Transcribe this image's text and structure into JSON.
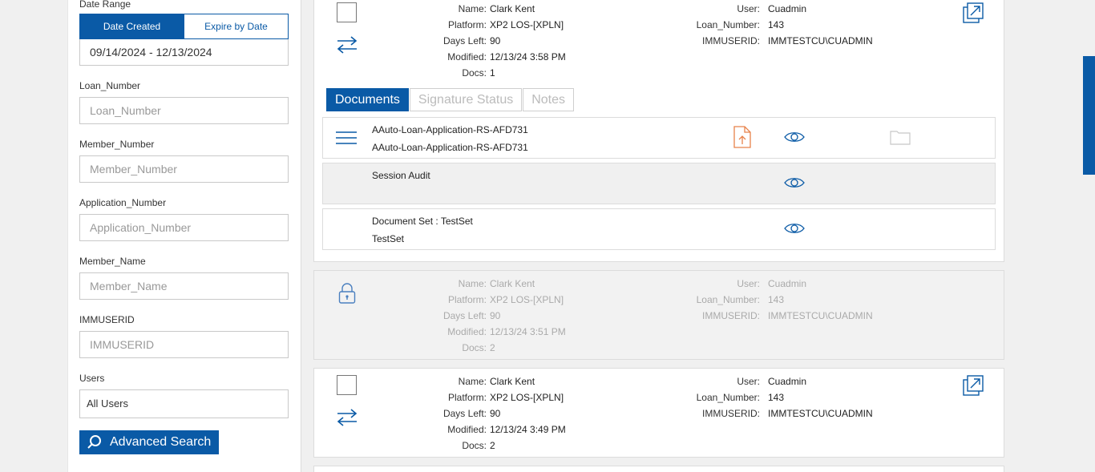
{
  "filters": {
    "date_range_label": "Date Range",
    "date_created_label": "Date Created",
    "expire_by_date_label": "Expire by Date",
    "date_range_value": "09/14/2024 - 12/13/2024",
    "loan_number_label": "Loan_Number",
    "loan_number_placeholder": "Loan_Number",
    "member_number_label": "Member_Number",
    "member_number_placeholder": "Member_Number",
    "application_number_label": "Application_Number",
    "application_number_placeholder": "Application_Number",
    "member_name_label": "Member_Name",
    "member_name_placeholder": "Member_Name",
    "immuserid_label": "IMMUSERID",
    "immuserid_placeholder": "IMMUSERID",
    "users_label": "Users",
    "users_value": "All Users",
    "advanced_search_label": "Advanced Search"
  },
  "field_labels": {
    "name": "Name:",
    "platform": "Platform:",
    "days_left": "Days Left:",
    "modified": "Modified:",
    "docs": "Docs:",
    "user": "User:",
    "loan_number": "Loan_Number:",
    "immuserid": "IMMUSERID:"
  },
  "cards": [
    {
      "name": "Clark Kent",
      "platform": "XP2 LOS-[XPLN]",
      "days_left": "90",
      "modified": "12/13/24 3:58 PM",
      "docs": "1",
      "user": "Cuadmin",
      "loan_number": "143",
      "immuserid": "IMMTESTCU\\CUADMIN",
      "tabs": [
        "Documents",
        "Signature Status",
        "Notes"
      ],
      "documents": [
        {
          "line1": "AAuto-Loan-Application-RS-AFD731",
          "line2": "AAuto-Loan-Application-RS-AFD731"
        },
        {
          "line1": "Session Audit",
          "line2": ""
        },
        {
          "line1": "Document Set : TestSet",
          "line2": "TestSet"
        }
      ]
    },
    {
      "name": "Clark Kent",
      "platform": "XP2 LOS-[XPLN]",
      "days_left": "90",
      "modified": "12/13/24 3:51 PM",
      "docs": "2",
      "user": "Cuadmin",
      "loan_number": "143",
      "immuserid": "IMMTESTCU\\CUADMIN"
    },
    {
      "name": "Clark Kent",
      "platform": "XP2 LOS-[XPLN]",
      "days_left": "90",
      "modified": "12/13/24 3:49 PM",
      "docs": "2",
      "user": "Cuadmin",
      "loan_number": "143",
      "immuserid": "IMMTESTCU\\CUADMIN"
    }
  ],
  "colors": {
    "accent": "#0a5aa6",
    "upload_icon": "#e8824a",
    "locked_bg": "#f2f2f2"
  }
}
